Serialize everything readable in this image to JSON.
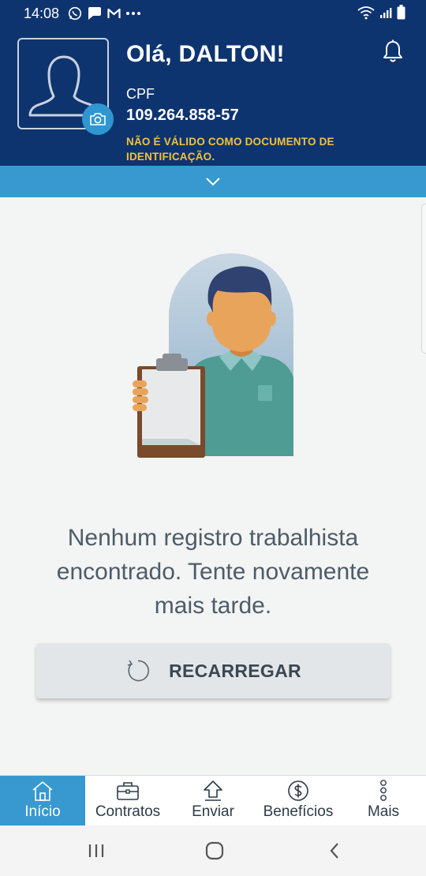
{
  "status_bar": {
    "time": "14:08",
    "icons_left": [
      "whatsapp-icon",
      "pinterest-icon",
      "gmail-icon",
      "more-dots-icon"
    ],
    "icons_right": [
      "wifi-icon",
      "signal-icon",
      "battery-icon"
    ]
  },
  "header": {
    "greeting": "Olá, DALTON!",
    "cpf_label": "CPF",
    "cpf_value": "109.264.858-57",
    "warning": "NÃO É VÁLIDO COMO DOCUMENTO DE IDENTIFICAÇÃO."
  },
  "main": {
    "empty_message": "Nenhum registro trabalhista encontrado. Tente novamente mais tarde.",
    "reload_label": "RECARREGAR"
  },
  "tabs": [
    {
      "label": "Início",
      "icon": "home-icon",
      "active": true
    },
    {
      "label": "Contratos",
      "icon": "briefcase-icon",
      "active": false
    },
    {
      "label": "Enviar",
      "icon": "upload-icon",
      "active": false
    },
    {
      "label": "Benefícios",
      "icon": "dollar-coin-icon",
      "active": false
    },
    {
      "label": "Mais",
      "icon": "vertical-dots-icon",
      "active": false
    }
  ],
  "colors": {
    "header_bg": "#0e3470",
    "accent": "#3799cf",
    "warning": "#f2c23a"
  }
}
